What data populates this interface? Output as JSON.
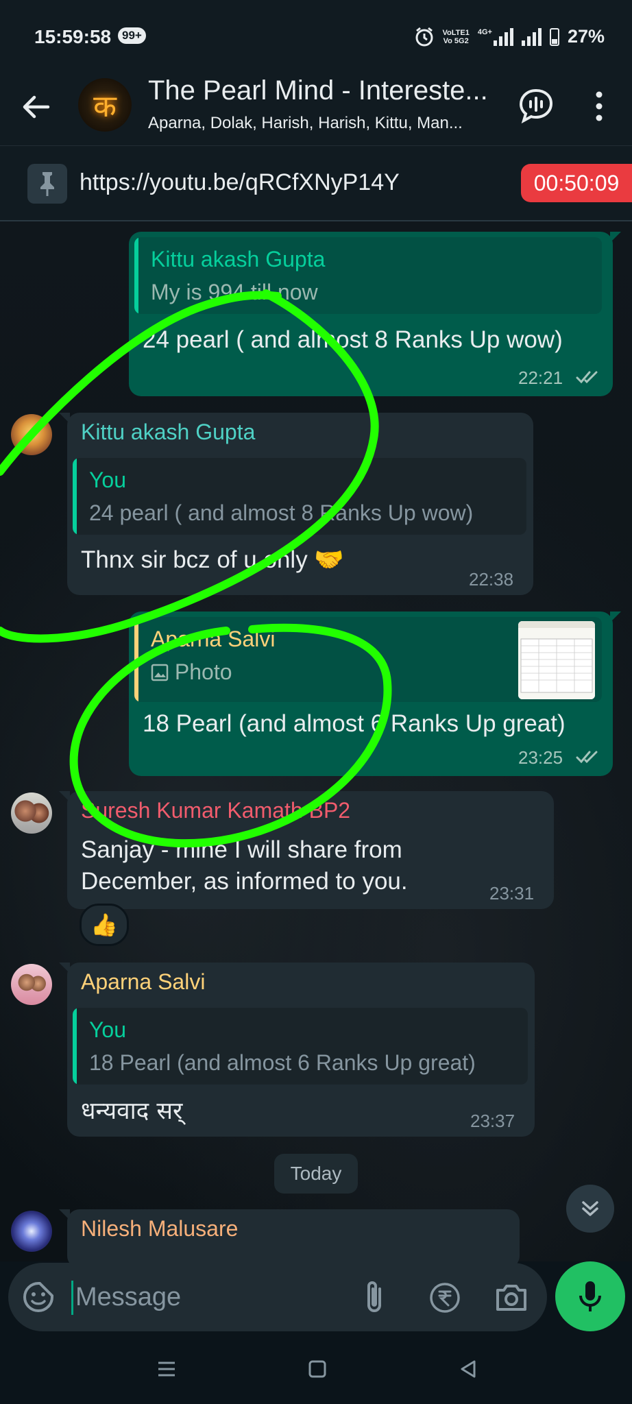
{
  "status_bar": {
    "time": "15:59:58",
    "badge": "99+",
    "volte_top": "VoLTE1",
    "volte_bottom": "Vo 5G2",
    "network": "4G+",
    "battery": "27%"
  },
  "header": {
    "title": "The Pearl Mind - Intereste...",
    "members": "Aparna, Dolak, Harish, Harish, Kittu, Man...",
    "avatar_glyph": "क"
  },
  "pinned": {
    "link": "https://youtu.be/qRCfXNyP14Y",
    "timer": "00:50:09"
  },
  "messages": [
    {
      "direction": "out",
      "quote_name": "Kittu akash Gupta",
      "quote_text": "My is 994 till now",
      "text": "24 pearl ( and almost 8 Ranks Up wow)",
      "time": "22:21"
    },
    {
      "direction": "in",
      "sender": "Kittu akash Gupta",
      "quote_name": "You",
      "quote_text": "24 pearl ( and almost 8 Ranks Up wow)",
      "text": "Thnx sir bcz of u only 🤝",
      "time": "22:38"
    },
    {
      "direction": "out",
      "quote_name": "Aparna Salvi",
      "quote_text": "Photo",
      "text": "18 Pearl (and almost 6 Ranks Up great)",
      "time": "23:25"
    },
    {
      "direction": "in",
      "sender": "Suresh Kumar Kamath BP2",
      "text_line1": "Sanjay - mine I will share from",
      "text_line2": "December, as informed to you.",
      "time": "23:31",
      "reaction": "👍"
    },
    {
      "direction": "in",
      "sender": "Aparna Salvi",
      "quote_name": "You",
      "quote_text": "18 Pearl (and almost 6 Ranks Up great)",
      "text": "धन्यवाद सर्",
      "time": "23:37"
    },
    {
      "direction": "in",
      "sender": "Nilesh Malusare"
    }
  ],
  "date_divider": "Today",
  "composer": {
    "placeholder": "Message"
  },
  "colors": {
    "accent_green": "#21c063",
    "outgoing_bubble": "#005c4b",
    "incoming_bubble": "#202c33",
    "timer_red": "#ea3b40",
    "sender_teal": "#53bdeb",
    "sender_kittu": "#4fd1c5",
    "sender_suresh": "#f15c6d",
    "sender_aparna": "#ffd279",
    "sender_nilesh": "#f7b07a",
    "annotation_green": "#22ff00"
  }
}
